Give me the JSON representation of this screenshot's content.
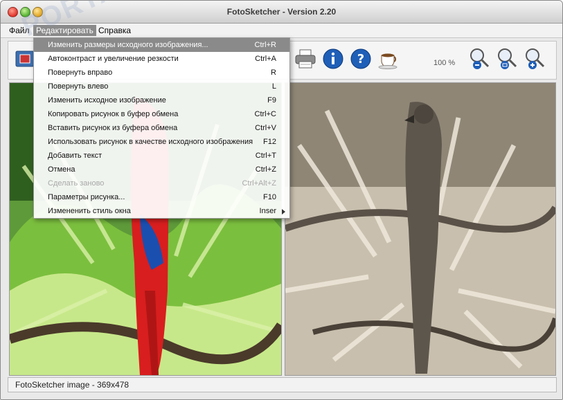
{
  "window": {
    "title": "FotoSketcher - Version 2.20"
  },
  "menubar": {
    "items": [
      "Файл",
      "Редактировать",
      "Справка"
    ]
  },
  "toolbar": {
    "zoom_label": "100 %"
  },
  "edit_menu": {
    "items": [
      {
        "label": "Изменить размеры исходного изображения...",
        "shortcut": "Ctrl+R"
      },
      {
        "label": "Автоконтраст и увеличение резкости",
        "shortcut": "Ctrl+A"
      },
      {
        "label": "Повернуть вправо",
        "shortcut": "R"
      },
      {
        "label": "Повернуть влево",
        "shortcut": "L"
      },
      {
        "label": "Изменить исходное изображение",
        "shortcut": "F9"
      },
      {
        "label": "Копировать рисунок в буфер обмена",
        "shortcut": "Ctrl+C"
      },
      {
        "label": "Вставить рисунок из буфера обмена",
        "shortcut": "Ctrl+V"
      },
      {
        "label": "Использовать рисунок в качестве исходного изображения",
        "shortcut": "F12"
      },
      {
        "label": "Добавить текст",
        "shortcut": "Ctrl+T"
      },
      {
        "label": "Отмена",
        "shortcut": "Ctrl+Z"
      },
      {
        "label": "Сделать заново",
        "shortcut": "Ctrl+Alt+Z"
      },
      {
        "label": "Параметры рисунка...",
        "shortcut": "F10"
      },
      {
        "label": "Измененить стиль окна",
        "shortcut": "Inser"
      }
    ]
  },
  "status": {
    "text": "FotoSketcher image - 369x478"
  },
  "watermark": {
    "text": "PORTAL"
  },
  "colors": {
    "highlight": "#8a8a8a",
    "info_blue": "#1f5fb8",
    "parrot_red": "#d81e1e",
    "sepia": "#c9bfae"
  }
}
